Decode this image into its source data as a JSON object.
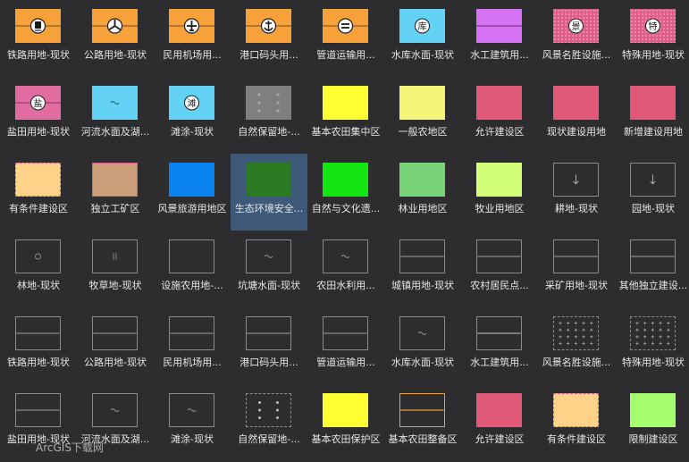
{
  "items": [
    {
      "label": "铁路用地-现状",
      "icon": "train-icon",
      "style": {
        "bg": "#f7a13a",
        "line": "#6e4a1e",
        "glyph": "train"
      }
    },
    {
      "label": "公路用地-现状",
      "icon": "road-icon",
      "style": {
        "bg": "#f7a13a",
        "line": "#6e4a1e",
        "glyph": "road"
      }
    },
    {
      "label": "民用机场用...",
      "icon": "airplane-icon",
      "style": {
        "bg": "#f7a13a",
        "line": "#6e4a1e",
        "glyph": "plane"
      }
    },
    {
      "label": "港口码头用...",
      "icon": "anchor-icon",
      "style": {
        "bg": "#f7a13a",
        "line": "#6e4a1e",
        "glyph": "anchor"
      }
    },
    {
      "label": "管道运输用...",
      "icon": "pipe-icon",
      "style": {
        "bg": "#f7a13a",
        "line": "#6e4a1e",
        "glyph": "pipe"
      }
    },
    {
      "label": "水库水面-现状",
      "icon": "reservoir-icon",
      "style": {
        "bg": "#64d2f4",
        "glyph": "char",
        "char": "库"
      }
    },
    {
      "label": "水工建筑用...",
      "icon": "hydraulic-icon",
      "style": {
        "bg": "#d672f4",
        "line": "#7a3a8a",
        "glyph": "line"
      }
    },
    {
      "label": "风景名胜设施...",
      "icon": "scenic-icon",
      "style": {
        "bg": "#e05f8a",
        "pattern": "dots",
        "glyph": "char",
        "char": "景"
      }
    },
    {
      "label": "特殊用地-现状",
      "icon": "special-icon",
      "style": {
        "bg": "#e05f8a",
        "pattern": "dots",
        "glyph": "char",
        "char": "特"
      }
    },
    {
      "label": "盐田用地-现状",
      "icon": "salt-field-icon",
      "style": {
        "bg": "#e06ca0",
        "line": "#8a3a5a",
        "glyph": "char",
        "char": "盐"
      }
    },
    {
      "label": "河流水面及湖...",
      "icon": "wave-icon",
      "style": {
        "bg": "#64d2f4",
        "glyph": "wave",
        "wc": "#2d6a80"
      }
    },
    {
      "label": "滩涂-现状",
      "icon": "tidal-flat-icon",
      "style": {
        "bg": "#64d2f4",
        "glyph": "char",
        "char": "滩"
      }
    },
    {
      "label": "自然保留地-...",
      "icon": "dots-icon",
      "style": {
        "bg": "#7f7f7f",
        "glyph": "dots6",
        "dc": "#a9a9a9"
      }
    },
    {
      "label": "基本农田集中区",
      "icon": "swatch-icon",
      "style": {
        "bg": "#ffff32"
      }
    },
    {
      "label": "一般农地区",
      "icon": "swatch-icon",
      "style": {
        "bg": "#f5f57a"
      }
    },
    {
      "label": "允许建设区",
      "icon": "swatch-icon",
      "style": {
        "bg": "#e05a78"
      }
    },
    {
      "label": "现状建设用地",
      "icon": "swatch-icon",
      "style": {
        "bg": "#e05a78"
      }
    },
    {
      "label": "新增建设用地",
      "icon": "swatch-icon",
      "style": {
        "bg": "#e05a78"
      }
    },
    {
      "label": "有条件建设区",
      "icon": "swatch-icon",
      "style": {
        "bg": "#ffd28a",
        "border": "#e05f8a",
        "dashed": true
      }
    },
    {
      "label": "独立工矿区",
      "icon": "swatch-icon",
      "style": {
        "bg": "#cd9f7a",
        "border": "#e05f8a"
      }
    },
    {
      "label": "风景旅游用地区",
      "icon": "swatch-icon",
      "style": {
        "bg": "#0a82f0"
      }
    },
    {
      "label": "生态环境安全...",
      "icon": "swatch-icon",
      "style": {
        "bg": "#2a7a22"
      },
      "selected": true
    },
    {
      "label": "自然与文化遗...",
      "icon": "swatch-icon",
      "style": {
        "bg": "#14e614"
      }
    },
    {
      "label": "林业用地区",
      "icon": "swatch-icon",
      "style": {
        "bg": "#78d278"
      }
    },
    {
      "label": "牧业用地区",
      "icon": "swatch-icon",
      "style": {
        "bg": "#d2ff78"
      }
    },
    {
      "label": "耕地-现状",
      "icon": "arrow-down-icon",
      "style": {
        "border": "#8c8c8c",
        "glyph": "arrow"
      }
    },
    {
      "label": "园地-现状",
      "icon": "arrow-down-icon",
      "style": {
        "border": "#8c8c8c",
        "glyph": "arrow"
      }
    },
    {
      "label": "林地-现状",
      "icon": "circle-icon",
      "style": {
        "border": "#8c8c8c",
        "glyph": "circle"
      }
    },
    {
      "label": "牧草地-现状",
      "icon": "pause-icon",
      "style": {
        "border": "#8c8c8c",
        "glyph": "bars"
      }
    },
    {
      "label": "设施农用地-...",
      "icon": "outline-icon",
      "style": {
        "border": "#8c8c8c"
      }
    },
    {
      "label": "坑塘水面-现状",
      "icon": "wave-icon",
      "style": {
        "border": "#8c8c8c",
        "glyph": "wave",
        "wc": "#8c8c8c"
      }
    },
    {
      "label": "农田水利用...",
      "icon": "wave-icon",
      "style": {
        "border": "#8c8c8c",
        "glyph": "wave",
        "wc": "#8c8c8c"
      }
    },
    {
      "label": "城镇用地-现状",
      "icon": "line-icon",
      "style": {
        "border": "#8c8c8c",
        "glyph": "line",
        "lc": "#8c8c8c"
      }
    },
    {
      "label": "农村居民点...",
      "icon": "line-icon",
      "style": {
        "border": "#8c8c8c",
        "glyph": "line",
        "lc": "#8c8c8c"
      }
    },
    {
      "label": "采矿用地-现状",
      "icon": "line-icon",
      "style": {
        "border": "#8c8c8c",
        "glyph": "line",
        "lc": "#8c8c8c"
      }
    },
    {
      "label": "其他独立建设...",
      "icon": "line-icon",
      "style": {
        "border": "#8c8c8c",
        "glyph": "line",
        "lc": "#8c8c8c"
      }
    },
    {
      "label": "铁路用地-现状",
      "icon": "line-icon",
      "style": {
        "border": "#8c8c8c",
        "glyph": "line",
        "lc": "#8c8c8c"
      }
    },
    {
      "label": "公路用地-现状",
      "icon": "line-icon",
      "style": {
        "border": "#8c8c8c",
        "glyph": "line",
        "lc": "#8c8c8c"
      }
    },
    {
      "label": "民用机场用...",
      "icon": "line-icon",
      "style": {
        "border": "#8c8c8c",
        "glyph": "line",
        "lc": "#8c8c8c"
      }
    },
    {
      "label": "港口码头用...",
      "icon": "line-icon",
      "style": {
        "border": "#8c8c8c",
        "glyph": "line",
        "lc": "#8c8c8c"
      }
    },
    {
      "label": "管道运输用...",
      "icon": "line-icon",
      "style": {
        "border": "#8c8c8c",
        "glyph": "line",
        "lc": "#8c8c8c"
      }
    },
    {
      "label": "水库水面-现状",
      "icon": "wave-icon",
      "style": {
        "border": "#8c8c8c",
        "glyph": "wave",
        "wc": "#8c8c8c"
      }
    },
    {
      "label": "水工建筑用...",
      "icon": "line-icon",
      "style": {
        "border": "#8c8c8c",
        "glyph": "line",
        "lc": "#b0b0b0"
      }
    },
    {
      "label": "风景名胜设施...",
      "icon": "plus-grid-icon",
      "style": {
        "border": "#8c8c8c",
        "dashed": true,
        "glyph": "plus"
      }
    },
    {
      "label": "特殊用地-现状",
      "icon": "plus-grid-icon",
      "style": {
        "border": "#8c8c8c",
        "dashed": true,
        "glyph": "plus"
      }
    },
    {
      "label": "盐田用地-现状",
      "icon": "line-icon",
      "style": {
        "border": "#8c8c8c",
        "glyph": "line",
        "lc": "#8c8c8c"
      }
    },
    {
      "label": "河流水面及湖...",
      "icon": "wave-icon",
      "style": {
        "border": "#8c8c8c",
        "glyph": "wave",
        "wc": "#8c8c8c"
      }
    },
    {
      "label": "滩涂-现状",
      "icon": "wave-icon",
      "style": {
        "border": "#8c8c8c",
        "glyph": "wave",
        "wc": "#8c8c8c"
      }
    },
    {
      "label": "自然保留地-...",
      "icon": "dots-icon",
      "style": {
        "border": "#8c8c8c",
        "dashed": true,
        "glyph": "dots6",
        "dc": "#bdbdbd"
      }
    },
    {
      "label": "基本农田保护区",
      "icon": "swatch-icon",
      "style": {
        "bg": "#ffff32"
      }
    },
    {
      "label": "基本农田整备区",
      "icon": "line-icon",
      "style": {
        "border": "#e6a23a",
        "glyph": "line",
        "lc": "#e6a23a"
      }
    },
    {
      "label": "允许建设区",
      "icon": "swatch-icon",
      "style": {
        "bg": "#e05a78"
      }
    },
    {
      "label": "有条件建设区",
      "icon": "swatch-icon",
      "style": {
        "bg": "#ffd28a",
        "border": "#e05f8a",
        "dashed": true
      }
    },
    {
      "label": "限制建设区",
      "icon": "swatch-icon",
      "style": {
        "bg": "#a5ff6e"
      }
    }
  ],
  "watermark": "ArcGIS下载网"
}
